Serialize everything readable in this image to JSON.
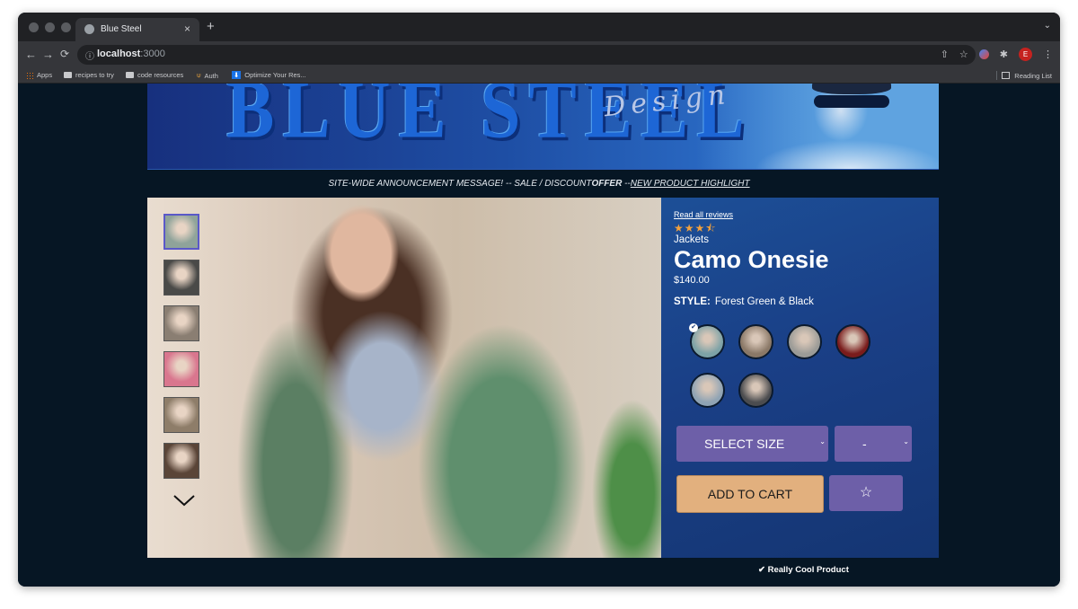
{
  "browser": {
    "tab_title": "Blue Steel",
    "tab_close": "×",
    "new_tab": "+",
    "menu_caret": "⌄",
    "url_host": "localhost",
    "url_port": ":3000",
    "info_icon": "ⓘ",
    "profile_initial": "E",
    "bookmarks": [
      "Apps",
      "recipes to try",
      "code resources",
      "Auth",
      "Optimize Your Res..."
    ],
    "reading_list": "Reading List"
  },
  "banner": {
    "brand_text": "BLUE STEEL",
    "script_text": "Design"
  },
  "announcement": {
    "lead": "SITE-WIDE ANNOUNCEMENT MESSAGE! -- SALE / DISCOUNT",
    "bold": "OFFER",
    "sep": " --",
    "link": "NEW PRODUCT HIGHLIGHT"
  },
  "product": {
    "reviews_link": "Read all reviews",
    "stars": "★★★⯪",
    "rating": 3.5,
    "category": "Jackets",
    "name": "Camo Onesie",
    "price": "$140.00",
    "style_label": "STYLE:",
    "style_value": "Forest Green & Black",
    "styles": [
      {
        "color": "#7da2a6",
        "selected": true
      },
      {
        "color": "#8a7867",
        "selected": false
      },
      {
        "color": "#9b9b97",
        "selected": false
      },
      {
        "color": "#7a1c1c",
        "selected": false
      },
      {
        "color": "#8fa3b4",
        "selected": false
      },
      {
        "color": "#4b4c4f",
        "selected": false
      }
    ],
    "selected_check": "✔",
    "thumbnails": [
      "#8fa39a",
      "#4a4a48",
      "#8a7e72",
      "#d9768e",
      "#8e7d69",
      "#5a4538"
    ],
    "size_select": "SELECT SIZE",
    "qty_select": "-",
    "caret": "⌄",
    "add_to_cart": "ADD TO CART",
    "favorite_glyph": "☆",
    "feature": "✔ Really Cool Product"
  },
  "colors": {
    "page_bg": "#061624",
    "details_bg": "#1a3f86",
    "select_bg": "#6d5fa8",
    "cart_bg": "#e2b07e",
    "star": "#f3a13c"
  },
  "icons": [
    "back-arrow-icon",
    "forward-arrow-icon",
    "reload-icon",
    "info-icon",
    "share-icon",
    "bookmark-star-icon",
    "extensions-icon",
    "chevron-down-icon",
    "star-outline-icon",
    "checkmark-icon"
  ]
}
